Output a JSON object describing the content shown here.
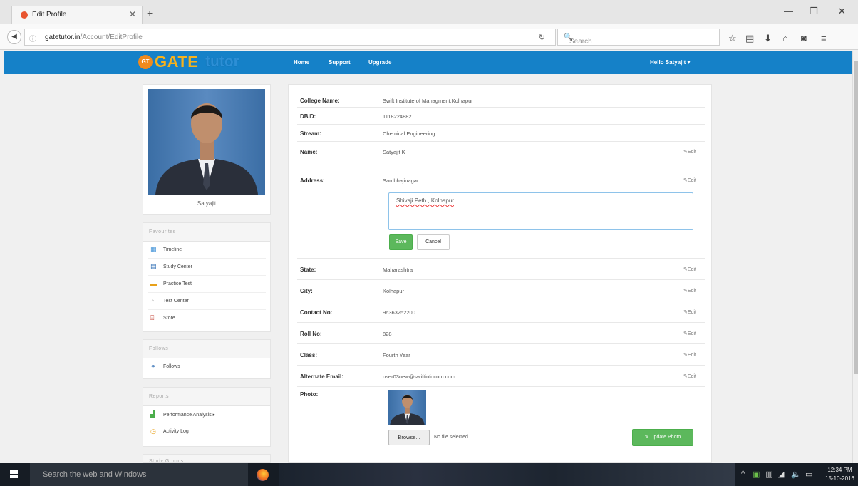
{
  "browser": {
    "tab_title": "Edit Profile",
    "url_host": "gatetutor.in",
    "url_path": "/Account/EditProfile",
    "search_placeholder": "Search"
  },
  "site": {
    "logo_badge": "GT",
    "logo_gate": "GATE",
    "logo_tutor": "tutor",
    "menu": [
      "Home",
      "Support",
      "Upgrade"
    ],
    "user_greeting": "Hello Satyajit ▾"
  },
  "sidebar": {
    "profile_name": "Satyajit",
    "favourites": {
      "title": "Favourites",
      "items": [
        {
          "label": "Timeline",
          "icon": "timeline-icon",
          "color": "#3a8fd6"
        },
        {
          "label": "Study Center",
          "icon": "study-center-icon",
          "color": "#2d6cb3"
        },
        {
          "label": "Practice Test",
          "icon": "practice-test-icon",
          "color": "#e8a11a"
        },
        {
          "label": "Test Center",
          "icon": "test-center-icon",
          "color": "#888888"
        },
        {
          "label": "Store",
          "icon": "store-icon",
          "color": "#c0392b"
        }
      ]
    },
    "follows": {
      "title": "Follows",
      "items": [
        {
          "label": "Follows",
          "icon": "follows-icon",
          "color": "#2d6cb3"
        }
      ]
    },
    "reports": {
      "title": "Reports",
      "items": [
        {
          "label": "Performance Analysis ▸",
          "icon": "performance-analysis-icon",
          "color": "#4cae4c"
        },
        {
          "label": "Activity Log",
          "icon": "activity-log-icon",
          "color": "#e8a11a"
        }
      ]
    },
    "study_groups": {
      "title": "Study Groups"
    }
  },
  "profile": {
    "college_label": "College Name:",
    "college_value": "Swift Institute of Managment,Kolhapur",
    "dbid_label": "DBID:",
    "dbid_value": "1118224882",
    "stream_label": "Stream:",
    "stream_value": "Chemical Engineering",
    "name_label": "Name:",
    "name_value": "Satyajit K",
    "address_label": "Address:",
    "address_value": "Sambhajinagar",
    "address_input": "Shivaji Peth , Kolhapur",
    "save_label": "Save",
    "cancel_label": "Cancel",
    "state_label": "State:",
    "state_value": "Maharashtra",
    "city_label": "City:",
    "city_value": "Kolhapur",
    "contact_label": "Contact No:",
    "contact_value": "96363252200",
    "roll_label": "Roll No:",
    "roll_value": "828",
    "class_label": "Class:",
    "class_value": "Fourth Year",
    "email_label": "Alternate Email:",
    "email_value": "user03new@swiftinfocom.com",
    "photo_label": "Photo:",
    "browse_label": "Browse...",
    "file_status": "No file selected.",
    "update_photo_label": "✎ Update Photo",
    "edit_label": "✎Edit"
  },
  "taskbar": {
    "search_placeholder": "Search the web and Windows",
    "time": "12:34 PM",
    "date": "15-10-2016"
  },
  "colors": {
    "header_blue": "#1581c8",
    "save_green": "#5cb85c"
  }
}
